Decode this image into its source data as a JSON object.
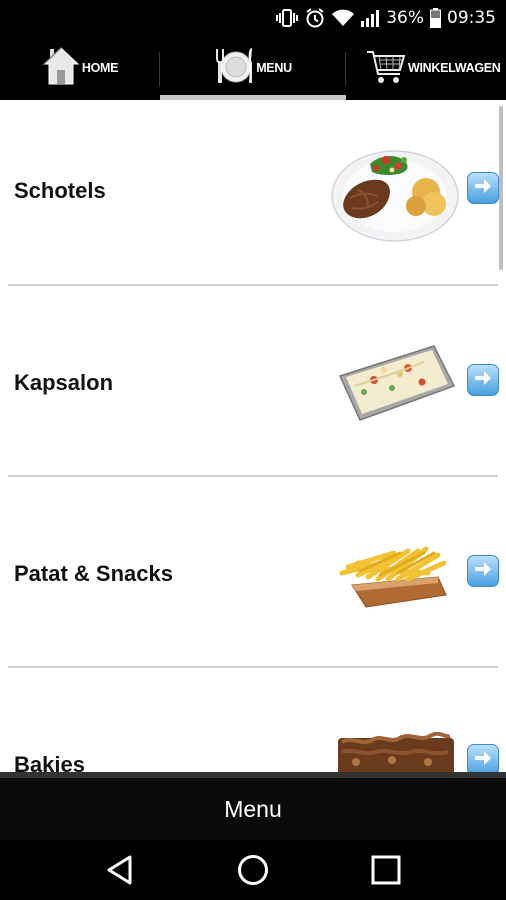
{
  "status_bar": {
    "battery_percent": "36%",
    "time": "09:35",
    "icons": [
      "vibrate-icon",
      "alarm-icon",
      "wifi-icon",
      "signal-icon",
      "battery-icon"
    ]
  },
  "nav": {
    "tabs": [
      {
        "label": "HOME",
        "icon": "home-icon",
        "active": false
      },
      {
        "label": "MENU",
        "icon": "plate-icon",
        "active": true
      },
      {
        "label": "WINKELWAGEN",
        "icon": "cart-icon",
        "active": false
      }
    ]
  },
  "menu": {
    "items": [
      {
        "label": "Schotels",
        "icon": "dish-platter-icon"
      },
      {
        "label": "Kapsalon",
        "icon": "kapsalon-tray-icon"
      },
      {
        "label": "Patat & Snacks",
        "icon": "fries-tray-icon"
      },
      {
        "label": "Bakjes",
        "icon": "meat-tray-icon"
      }
    ]
  },
  "footer": {
    "title": "Menu"
  },
  "colors": {
    "accent_arrow": "#4a9fe0",
    "active_tab_indicator": "#c8c8c8",
    "divider": "#cfcfcf"
  }
}
